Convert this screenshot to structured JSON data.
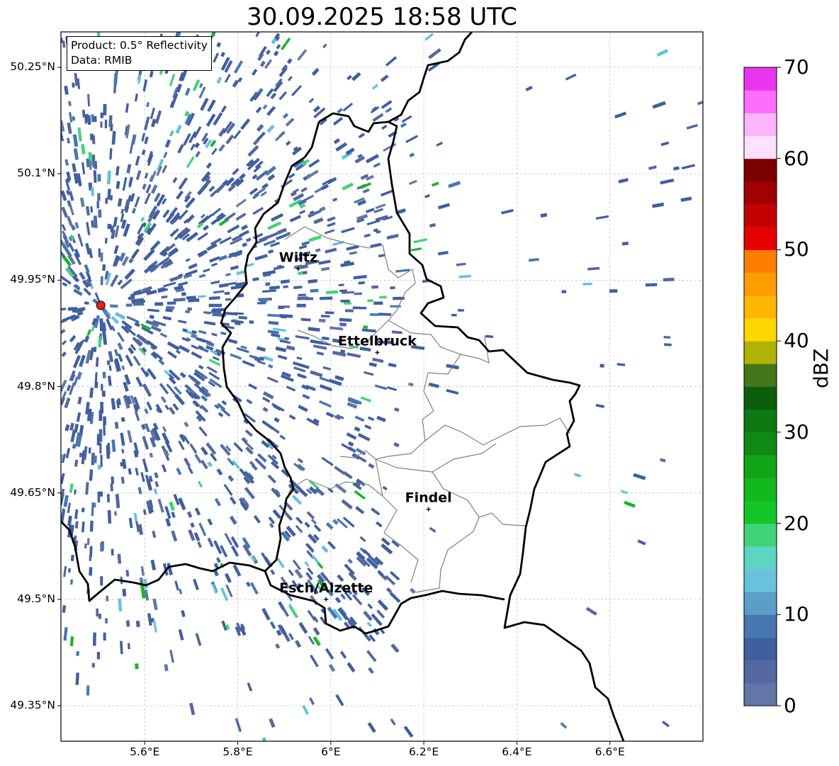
{
  "title": "30.09.2025 18:58 UTC",
  "info_box": {
    "product": "Product: 0.5° Reflectivity",
    "data": "Data: RMIB"
  },
  "axes": {
    "lon_range": [
      5.42,
      6.8
    ],
    "lat_range": [
      49.3,
      50.3
    ],
    "x_ticks": [
      {
        "lon": 5.6,
        "label": "5.6°E"
      },
      {
        "lon": 5.8,
        "label": "5.8°E"
      },
      {
        "lon": 6.0,
        "label": "6°E"
      },
      {
        "lon": 6.2,
        "label": "6.2°E"
      },
      {
        "lon": 6.4,
        "label": "6.4°E"
      },
      {
        "lon": 6.6,
        "label": "6.6°E"
      }
    ],
    "y_ticks": [
      {
        "lat": 50.25,
        "label": "50.25°N"
      },
      {
        "lat": 50.1,
        "label": "50.1°N"
      },
      {
        "lat": 49.95,
        "label": "49.95°N"
      },
      {
        "lat": 49.8,
        "label": "49.8°N"
      },
      {
        "lat": 49.65,
        "label": "49.65°N"
      },
      {
        "lat": 49.5,
        "label": "49.5°N"
      },
      {
        "lat": 49.35,
        "label": "49.35°N"
      }
    ],
    "gridlines": true
  },
  "cities": [
    {
      "name": "Wiltz",
      "lon": 5.93,
      "lat": 49.966
    },
    {
      "name": "Ettelbruck",
      "lon": 6.1,
      "lat": 49.848
    },
    {
      "name": "Findel",
      "lon": 6.21,
      "lat": 49.627
    },
    {
      "name": "Esch/Alzette",
      "lon": 5.99,
      "lat": 49.5
    }
  ],
  "radar_site": {
    "lon": 5.5056,
    "lat": 49.9145,
    "color": "#e0201b"
  },
  "colorbar": {
    "unit": "dBZ",
    "min": 0,
    "max": 70,
    "step": 2.5,
    "ticks": [
      {
        "value": 0,
        "label": "0"
      },
      {
        "value": 10,
        "label": "10"
      },
      {
        "value": 20,
        "label": "20"
      },
      {
        "value": 30,
        "label": "30"
      },
      {
        "value": 40,
        "label": "40"
      },
      {
        "value": 50,
        "label": "50"
      },
      {
        "value": 60,
        "label": "60"
      },
      {
        "value": 70,
        "label": "70"
      }
    ],
    "colors": [
      "#6277a8",
      "#5368a0",
      "#405fa1",
      "#4677b0",
      "#5b9ec8",
      "#66c2dd",
      "#5ed5c2",
      "#3fd477",
      "#13c627",
      "#13b81f",
      "#12a517",
      "#0f8b15",
      "#0e7812",
      "#0a5e0b",
      "#44761a",
      "#aeb305",
      "#ffd600",
      "#fdb703",
      "#fd9d00",
      "#ff7e00",
      "#e60101",
      "#c50202",
      "#a10101",
      "#7c0000",
      "#ffe0fe",
      "#ffb5fe",
      "#ff6dfe",
      "#ea35ee"
    ]
  }
}
